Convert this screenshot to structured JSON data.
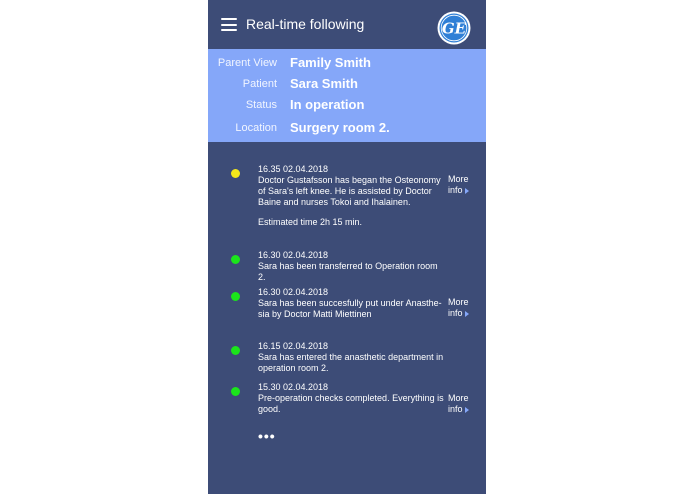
{
  "header": {
    "title": "Real-time following",
    "menu_icon": "hamburger-menu-icon",
    "logo_text": "GE"
  },
  "info": {
    "parent_view": {
      "label": "Parent View",
      "value": "Family Smith"
    },
    "patient": {
      "label": "Patient",
      "value": "Sara Smith"
    },
    "status": {
      "label": "Status",
      "value": "In operation"
    },
    "location": {
      "label": "Location",
      "value": "Surgery room 2."
    }
  },
  "timeline": {
    "more_label_1": "More",
    "more_label_2": "info",
    "ellipsis": "•••",
    "events": [
      {
        "time": "16.35   02.04.2018",
        "text": "Doctor Gustafsson has began the Osteonomy of Sara's left knee. He is assisted by Doctor Baine and nurses Tokoi and Ihalainen.",
        "extra": "Estimated time 2h 15 min.",
        "dot_color": "#f4e81a",
        "has_more_info": true
      },
      {
        "time": "16.30   02.04.2018",
        "text": "Sara has been transferred to Operation room 2.",
        "dot_color": "#1be51b",
        "has_more_info": false
      },
      {
        "time": "16.30   02.04.2018",
        "text": "Sara has been succesfully put under Anasthe-sia by Doctor Matti Miettinen",
        "dot_color": "#1be51b",
        "has_more_info": true
      },
      {
        "time": "16.15   02.04.2018",
        "text": "Sara has entered the anasthetic department in operation room 2.",
        "dot_color": "#1be51b",
        "has_more_info": false
      },
      {
        "time": "15.30   02.04.2018",
        "text": "Pre-operation checks completed. Everything is good.",
        "dot_color": "#1be51b",
        "has_more_info": true
      }
    ]
  },
  "colors": {
    "background": "#3d4c77",
    "info_panel": "#85a7f9",
    "status_in_progress": "#f4e81a",
    "status_done": "#1be51b"
  }
}
